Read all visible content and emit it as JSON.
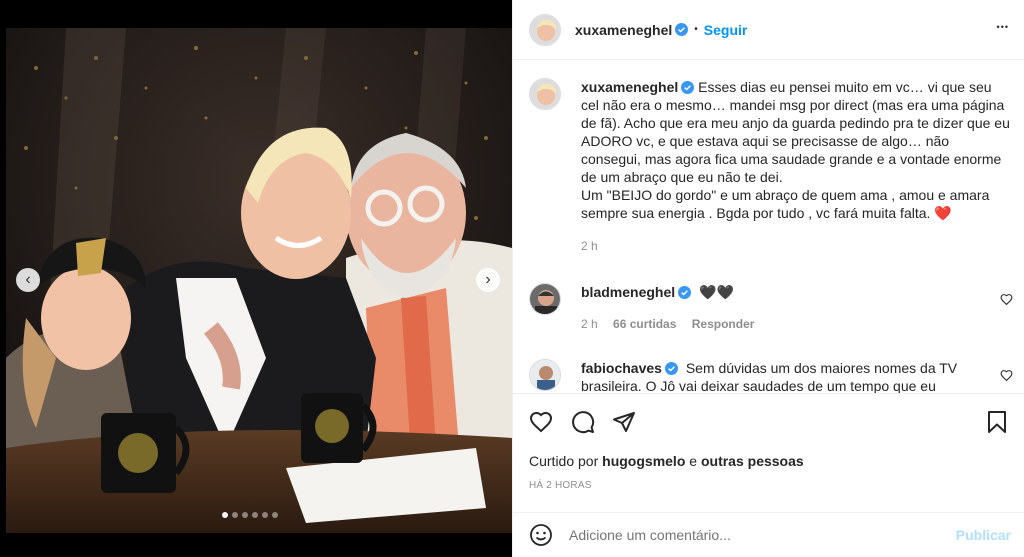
{
  "post": {
    "author": "xuxameneghel",
    "follow_label": "Seguir",
    "separator": "•",
    "more_label": "•••",
    "caption": "Esses dias eu pensei muito em vc… vi que seu cel não era o mesmo… mandei msg por direct (mas era uma página de fã). Acho que era meu anjo da guarda pedindo pra te dizer que eu ADORO vc, e que estava aqui se precisasse de algo… não consegui, mas agora fica uma saudade grande e a vontade enorme de um abraço que eu não te dei.",
    "caption_line2": "Um \"BEIJO do gordo\" e um abraço de quem ama , amou e amara sempre sua energia . Bgda por tudo , vc fará muita falta. ",
    "caption_heart": "❤️",
    "caption_time": "2 h"
  },
  "comments": [
    {
      "user": "bladmeneghel",
      "text": "🖤🖤",
      "time": "2 h",
      "likes": "66 curtidas",
      "reply_label": "Responder"
    },
    {
      "user": "fabiochaves",
      "text": "Sem dúvidas um dos maiores nomes da TV brasileira. O Jô vai deixar saudades de um tempo que eu"
    }
  ],
  "likes_line": {
    "prefix": "Curtido por ",
    "user": "hugogsmelo",
    "middle": " e ",
    "others": "outras pessoas"
  },
  "timestamp": "HÁ 2 HORAS",
  "add_comment": {
    "placeholder": "Adicione um comentário...",
    "publish_label": "Publicar"
  },
  "carousel": {
    "prev": "‹",
    "next": "›",
    "slide_count": 6,
    "active_slide": 1
  },
  "colors": {
    "accent": "#0095f6",
    "verified": "#3897f0",
    "heart": "#ed4956",
    "muted": "#8e8e8e"
  }
}
